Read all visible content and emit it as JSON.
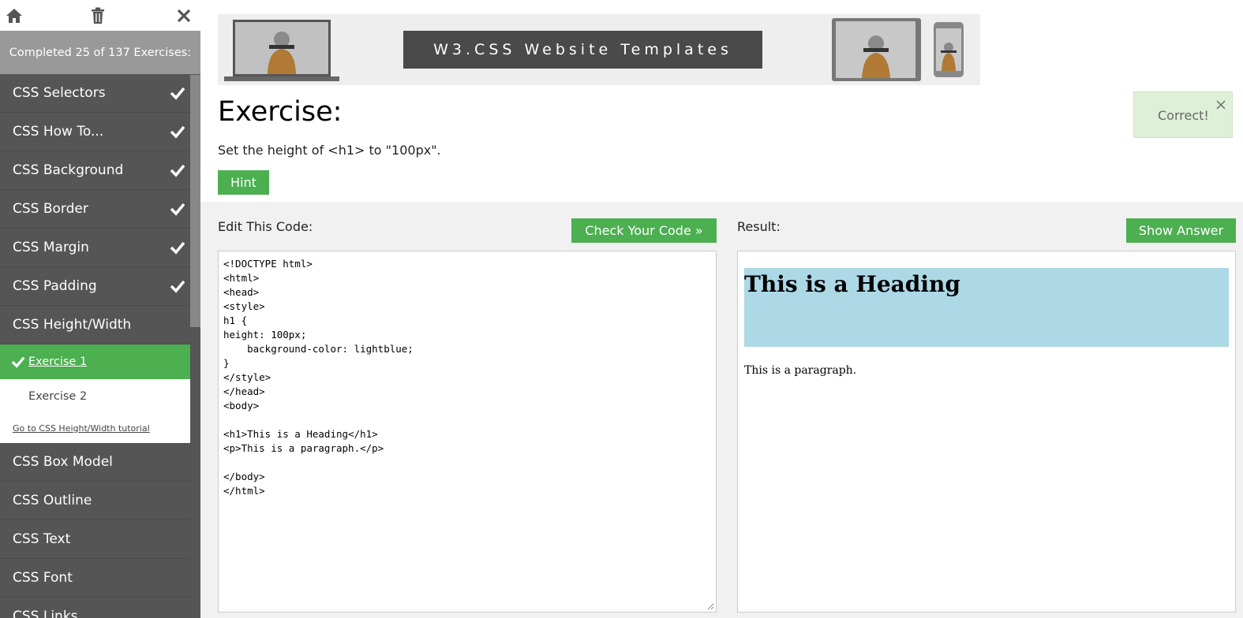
{
  "sidebar": {
    "icons": [
      "home-icon",
      "trash-icon",
      "close-icon"
    ],
    "progress_text": "Completed 25 of 137 Exercises:",
    "items_top": [
      {
        "label": "CSS Selectors",
        "done": true
      },
      {
        "label": "CSS How To...",
        "done": true
      },
      {
        "label": "CSS Background",
        "done": true
      },
      {
        "label": "CSS Border",
        "done": true
      },
      {
        "label": "CSS Margin",
        "done": true
      },
      {
        "label": "CSS Padding",
        "done": true
      },
      {
        "label": "CSS Height/Width",
        "done": false
      }
    ],
    "sub": {
      "exercise1": "Exercise 1",
      "exercise2": "Exercise 2",
      "tutorial_link": "Go to CSS Height/Width tutorial"
    },
    "items_bottom": [
      {
        "label": "CSS Box Model"
      },
      {
        "label": "CSS Outline"
      },
      {
        "label": "CSS Text"
      },
      {
        "label": "CSS Font"
      },
      {
        "label": "CSS Links"
      }
    ]
  },
  "banner": {
    "title": "W3.CSS Website Templates"
  },
  "exercise": {
    "title": "Exercise:",
    "description": "Set the height of <h1> to \"100px\".",
    "hint_label": "Hint",
    "toast": "Correct!"
  },
  "editor": {
    "label": "Edit This Code:",
    "check_button": "Check Your Code »",
    "code": "<!DOCTYPE html>\n<html>\n<head>\n<style>\nh1 {\nheight: 100px;\n    background-color: lightblue;\n}\n</style>\n</head>\n<body>\n\n<h1>This is a Heading</h1>\n<p>This is a paragraph.</p>\n\n</body>\n</html>"
  },
  "result": {
    "label": "Result:",
    "show_answer_button": "Show Answer",
    "heading": "This is a Heading",
    "paragraph": "This is a paragraph."
  },
  "colors": {
    "sidebar_bg": "#555555",
    "accent_green": "#4caf50",
    "progress_bg": "#999999",
    "result_h1_bg": "#add8e6",
    "toast_bg": "#dff0d8"
  }
}
